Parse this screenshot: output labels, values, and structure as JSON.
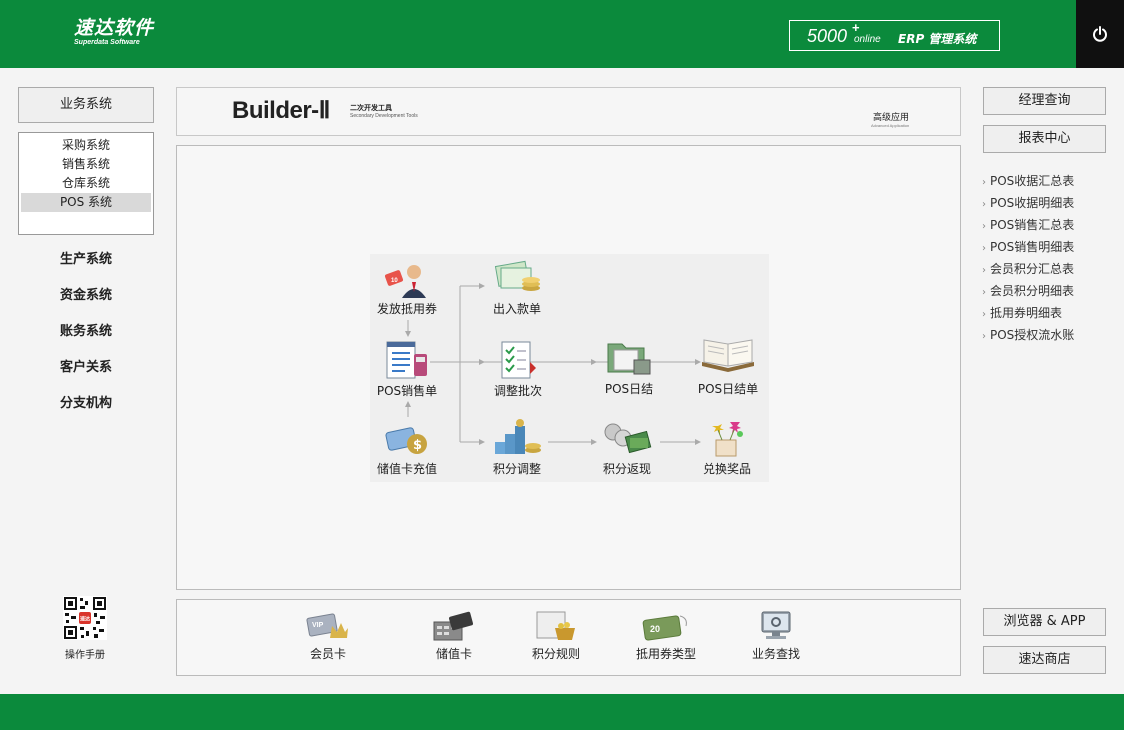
{
  "header": {
    "logo_cn": "速达软件",
    "logo_en": "Superdata Software",
    "product_num": "5000",
    "product_plus": "+",
    "product_online": "online",
    "product_name": "ERP 管理系统",
    "colors": {
      "brand_green": "#0b8a3c",
      "power_bg": "#101010"
    }
  },
  "left": {
    "business_btn": "业务系统",
    "sub_items": [
      "采购系统",
      "销售系统",
      "仓库系统",
      "POS 系统"
    ],
    "active_sub": "POS 系统",
    "systems": [
      "生产系统",
      "资金系统",
      "账务系统",
      "客户关系",
      "分支机构"
    ],
    "manual_label": "操作手册"
  },
  "banner": {
    "title": "Builder-Ⅱ",
    "subtitle_cn": "二次开发工具",
    "subtitle_en": "Secondary Development Tools",
    "advanced_cn": "高级应用",
    "advanced_en": "Advanced Application"
  },
  "flow": {
    "nodes": {
      "issue_coupon": "发放抵用券",
      "cash_in_out": "出入款单",
      "pos_sales": "POS销售单",
      "adjust_batch": "调整批次",
      "pos_close": "POS日结",
      "pos_close_bill": "POS日结单",
      "card_recharge": "储值卡充值",
      "points_adjust": "积分调整",
      "points_cashback": "积分返现",
      "redeem_prize": "兑换奖品"
    }
  },
  "shortcuts": [
    "会员卡",
    "储值卡",
    "积分规则",
    "抵用券类型",
    "业务查找"
  ],
  "right": {
    "manager_query": "经理查询",
    "report_center": "报表中心",
    "reports": [
      "POS收据汇总表",
      "POS收据明细表",
      "POS销售汇总表",
      "POS销售明细表",
      "会员积分汇总表",
      "会员积分明细表",
      "抵用券明细表",
      "POS授权流水账"
    ],
    "browser_app": "浏览器 & APP",
    "store": "速达商店"
  },
  "icons": {
    "power": "power-icon",
    "qr": "qr-code-icon"
  }
}
